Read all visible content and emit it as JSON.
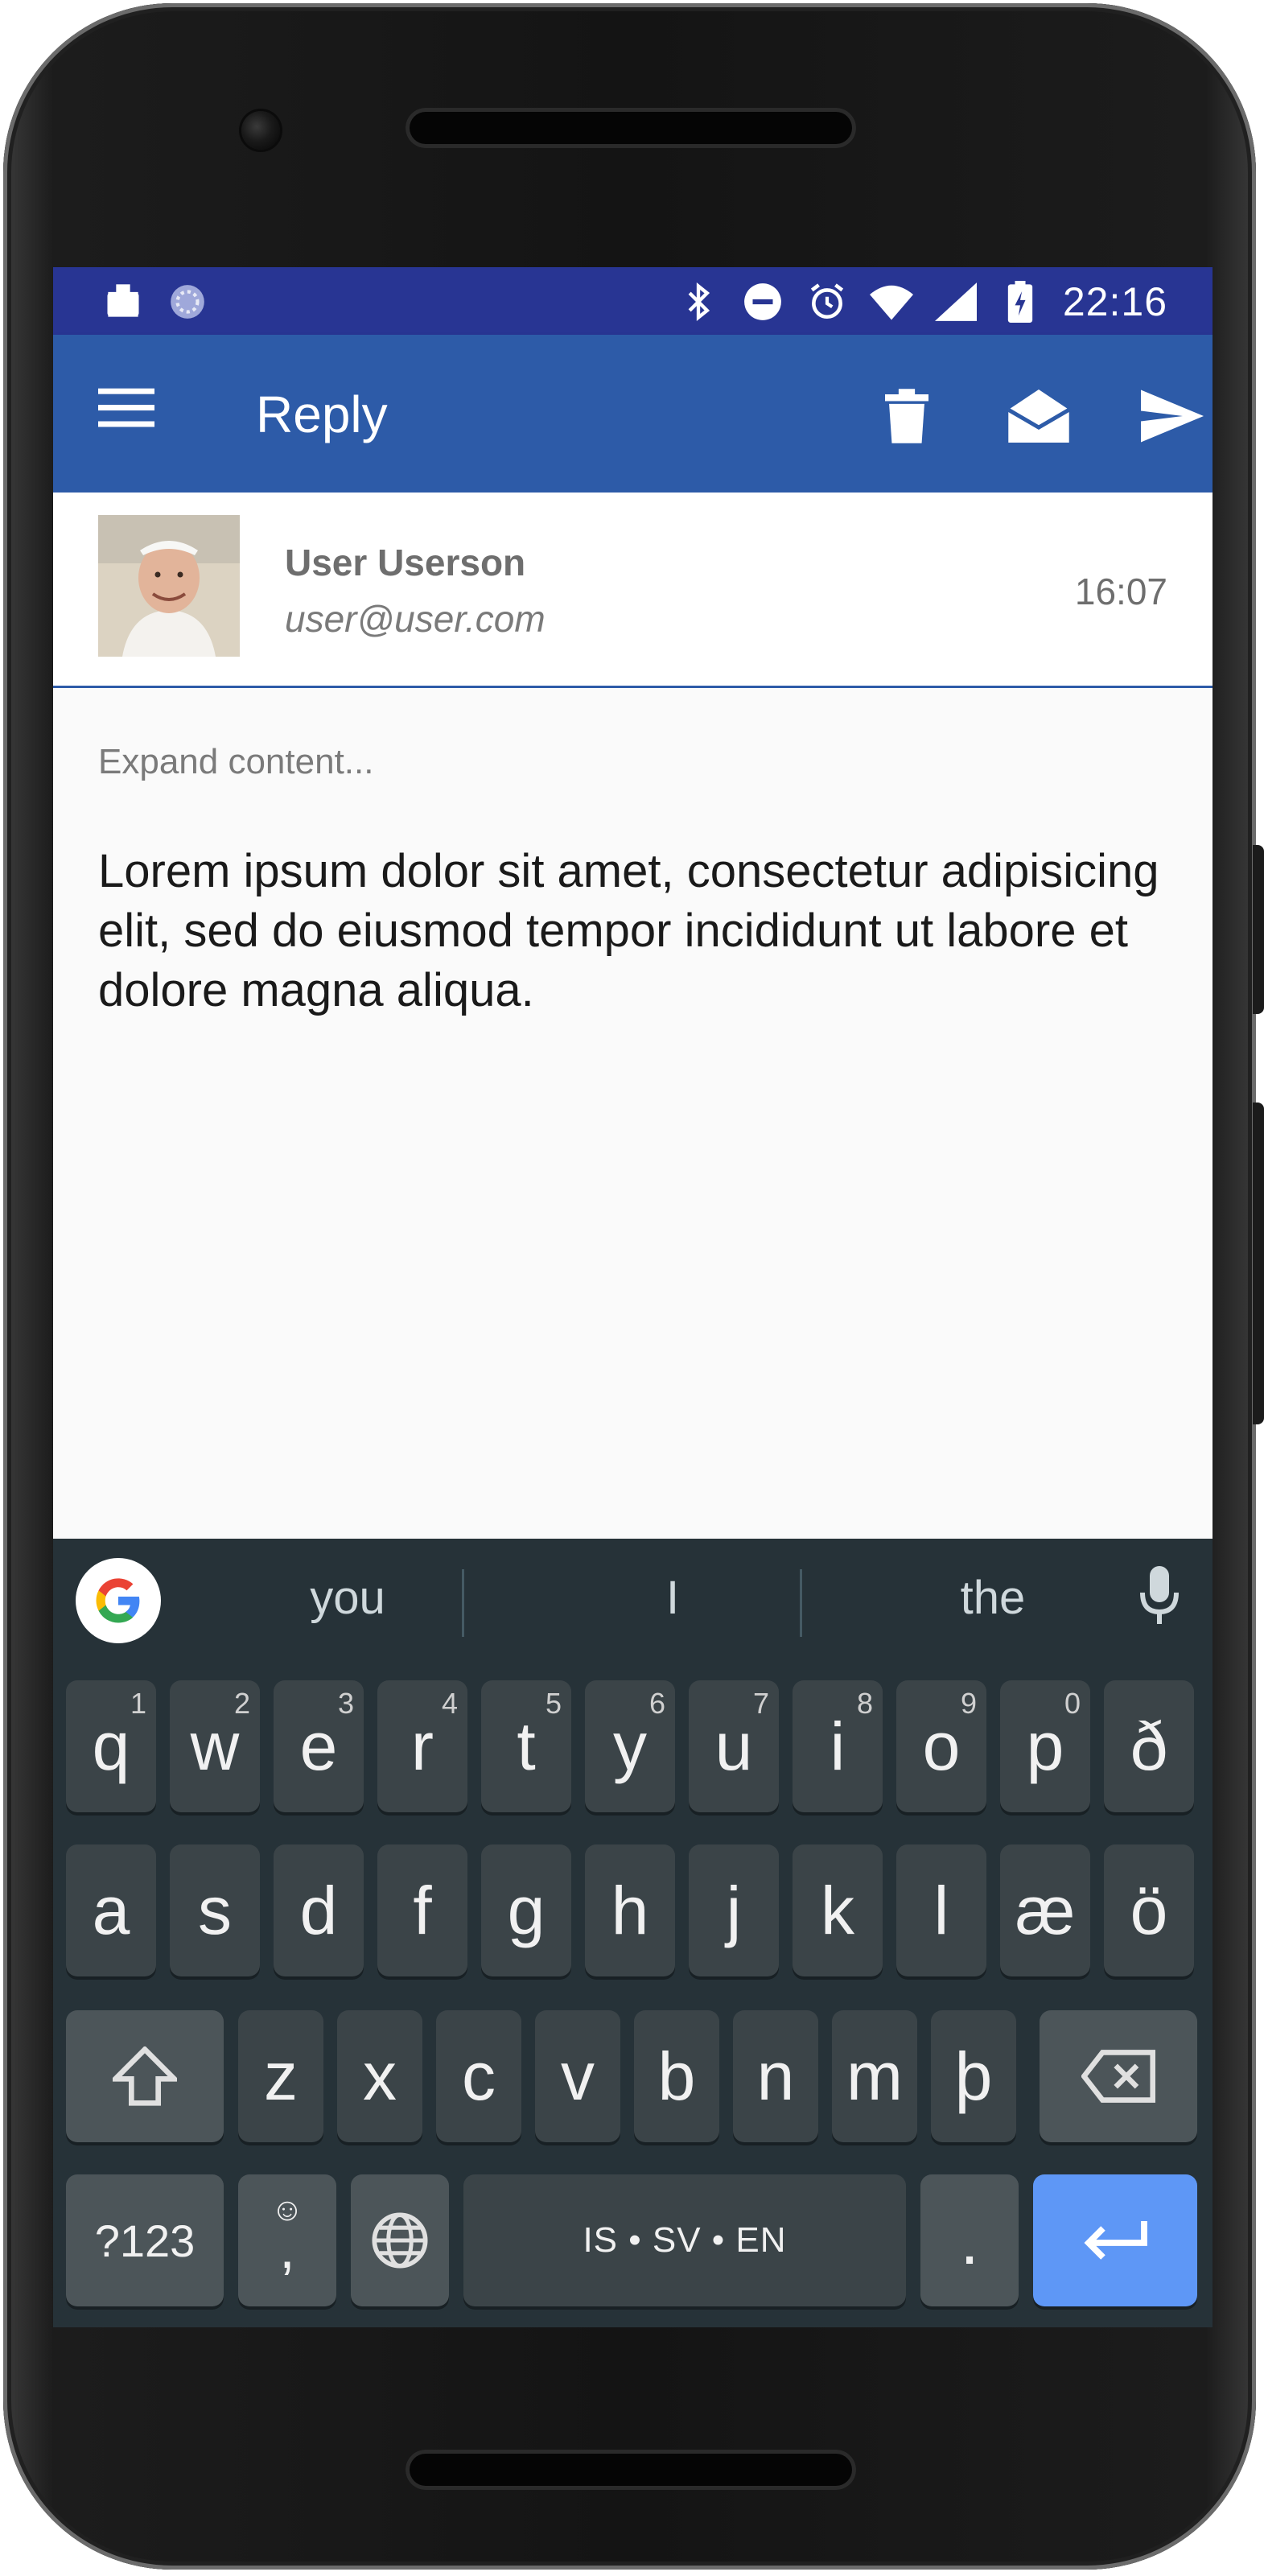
{
  "status_bar": {
    "time": "22:16",
    "left_icons": [
      "work-profile-icon",
      "sync-icon"
    ],
    "right_icons": [
      "bluetooth-icon",
      "do-not-disturb-icon",
      "alarm-icon",
      "wifi-icon",
      "signal-icon",
      "battery-charging-icon"
    ]
  },
  "app_bar": {
    "title": "Reply",
    "actions": [
      "delete-icon",
      "mark-read-icon",
      "send-icon"
    ]
  },
  "message": {
    "sender_name": "User Userson",
    "sender_email": "user@user.com",
    "time": "16:07",
    "expand_label": "Expand content...",
    "body": "Lorem ipsum dolor sit amet, consectetur adipisicing elit, sed do eiusmod tempor incididunt ut labore et dolore magna aliqua."
  },
  "keyboard": {
    "suggestions": [
      "you",
      "I",
      "the"
    ],
    "row1": [
      {
        "label": "q",
        "hint": "1"
      },
      {
        "label": "w",
        "hint": "2"
      },
      {
        "label": "e",
        "hint": "3"
      },
      {
        "label": "r",
        "hint": "4"
      },
      {
        "label": "t",
        "hint": "5"
      },
      {
        "label": "y",
        "hint": "6"
      },
      {
        "label": "u",
        "hint": "7"
      },
      {
        "label": "i",
        "hint": "8"
      },
      {
        "label": "o",
        "hint": "9"
      },
      {
        "label": "p",
        "hint": "0"
      },
      {
        "label": "ð",
        "hint": ""
      }
    ],
    "row2": [
      "a",
      "s",
      "d",
      "f",
      "g",
      "h",
      "j",
      "k",
      "l",
      "æ",
      "ö"
    ],
    "row3": [
      "z",
      "x",
      "c",
      "v",
      "b",
      "n",
      "m",
      "þ"
    ],
    "symbols_label": "?123",
    "comma_label": ",",
    "period_label": ".",
    "space_label": "IS • SV • EN",
    "accent_color": "#5e97f6"
  }
}
